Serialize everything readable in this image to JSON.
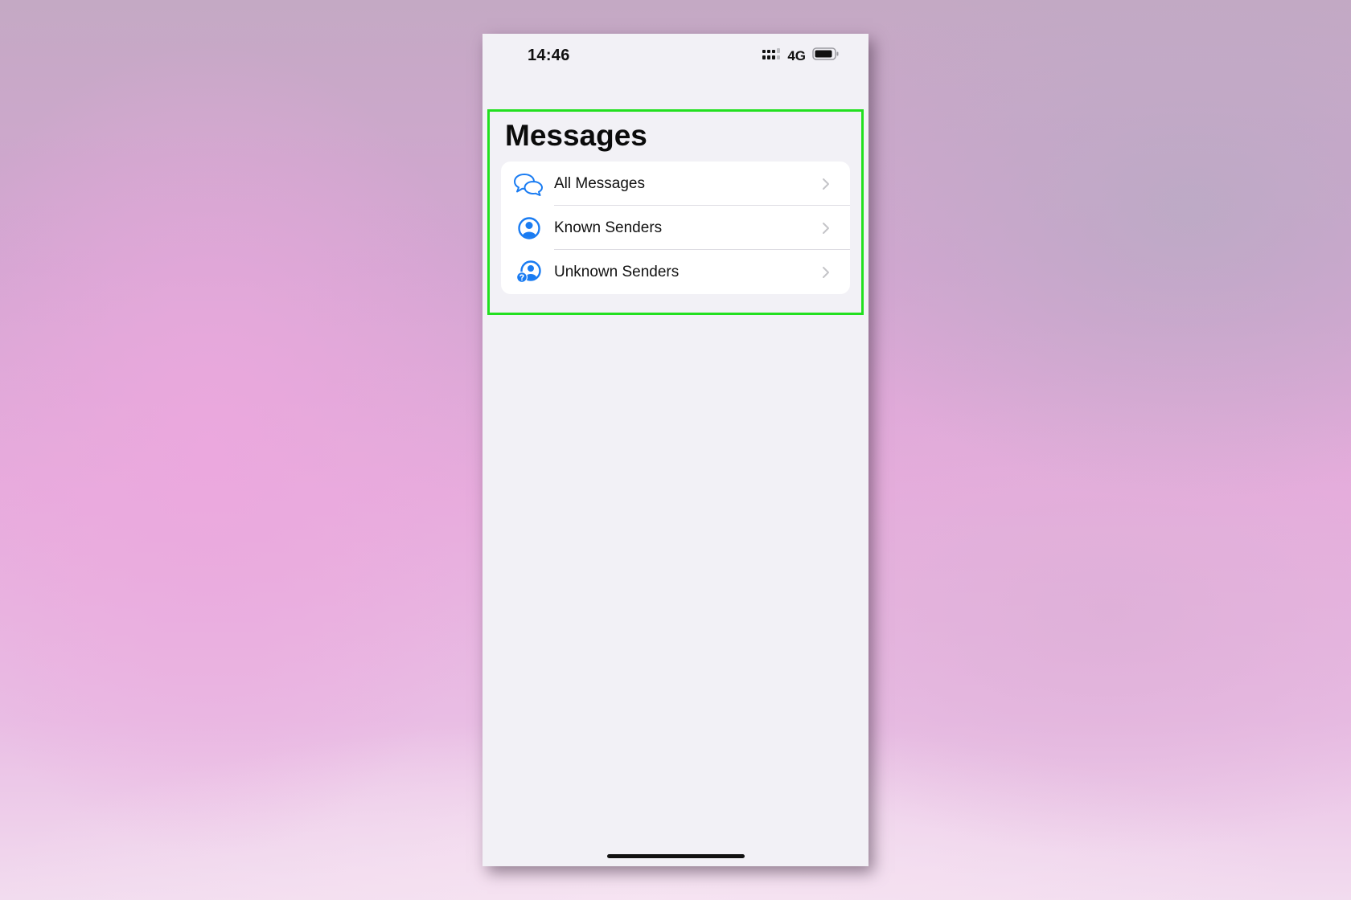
{
  "status_bar": {
    "time": "14:46",
    "network": "4G",
    "signal_icon": "signal-bars-icon",
    "battery_icon": "battery-icon"
  },
  "page": {
    "title": "Messages"
  },
  "filters": [
    {
      "label": "All Messages",
      "icon": "chat-bubbles-icon"
    },
    {
      "label": "Known Senders",
      "icon": "person-circle-icon"
    },
    {
      "label": "Unknown Senders",
      "icon": "person-question-icon"
    }
  ],
  "colors": {
    "accent": "#1a7cf2",
    "highlight": "#22e01f",
    "background": "#f2f1f6",
    "card": "#ffffff",
    "chevron": "#c4c4c8"
  }
}
